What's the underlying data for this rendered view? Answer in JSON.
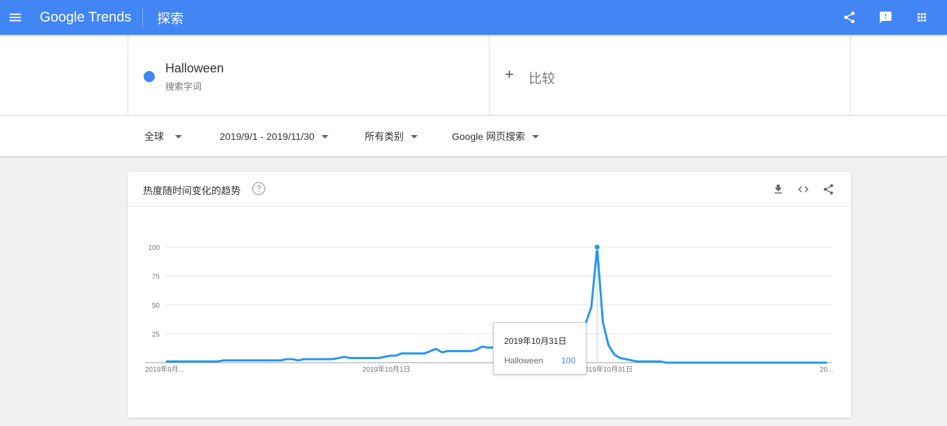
{
  "header": {
    "brand": "Google Trends",
    "page_title": "探索",
    "icons": [
      "menu-icon",
      "share-icon",
      "feedback-icon",
      "apps-grid-icon"
    ],
    "accent_color": "#4285f4"
  },
  "terms": {
    "term_name": "Halloween",
    "term_type": "搜索字词",
    "term_color": "#4285f4",
    "compare_plus": "+",
    "compare_label": "比较"
  },
  "filters": {
    "region": "全球",
    "date_range": "2019/9/1 - 2019/11/30",
    "category": "所有类别",
    "search_type": "Google 网页搜索"
  },
  "card": {
    "title": "热度随时间变化的趋势",
    "icons": [
      "help-icon",
      "download-icon",
      "embed-icon",
      "share-icon"
    ]
  },
  "tooltip": {
    "date": "2019年10月31日",
    "series": "Halloween",
    "value": "100"
  },
  "chart_data": {
    "type": "line",
    "series": [
      {
        "name": "Halloween",
        "color": "#2196f3",
        "values": [
          1,
          1,
          1,
          1,
          1,
          1,
          1,
          1,
          1,
          1,
          2,
          2,
          2,
          2,
          2,
          2,
          2,
          2,
          2,
          2,
          2,
          3,
          3,
          2,
          3,
          3,
          3,
          3,
          3,
          3,
          4,
          5,
          4,
          4,
          4,
          4,
          4,
          4,
          5,
          6,
          6,
          8,
          8,
          8,
          8,
          8,
          10,
          12,
          9,
          10,
          10,
          10,
          10,
          10,
          11,
          14,
          13,
          13,
          13,
          13,
          15,
          16,
          18,
          19,
          19,
          19,
          21,
          22,
          24,
          26,
          28,
          30,
          30,
          34,
          48,
          100,
          35,
          15,
          7,
          4,
          3,
          2,
          1,
          1,
          1,
          1,
          1,
          0,
          0,
          0,
          0,
          0,
          0,
          0,
          0,
          0,
          0,
          0,
          0,
          0,
          0,
          0,
          0,
          0,
          0,
          0,
          0,
          0,
          0,
          0,
          0,
          0,
          0,
          0,
          0,
          0
        ]
      }
    ],
    "y_ticks": [
      "100",
      "75",
      "50",
      "25"
    ],
    "ylim": [
      0,
      100
    ],
    "x_tick_labels": [
      "2019年9月...",
      "2019年10月1日",
      "2019年10月31日",
      "20..."
    ],
    "highlight_index": 75,
    "grid": true
  }
}
